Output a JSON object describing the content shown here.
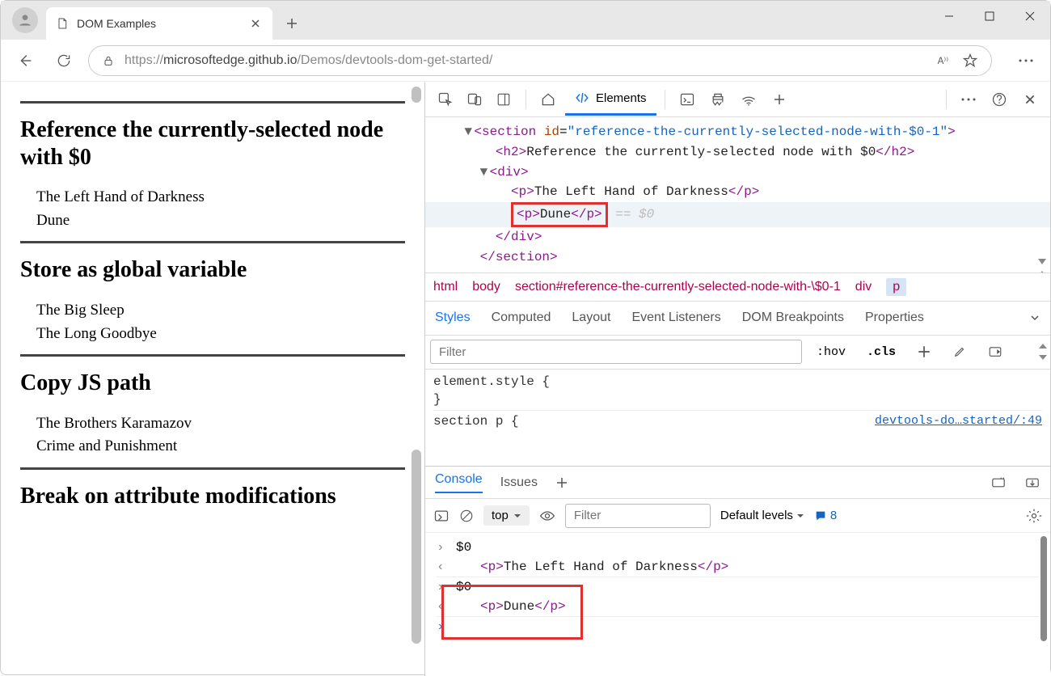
{
  "window": {
    "tab_title": "DOM Examples"
  },
  "address": {
    "scheme": "https://",
    "host": "microsoftedge.github.io",
    "path": "/Demos/devtools-dom-get-started/"
  },
  "page": {
    "sections": [
      {
        "heading": "Reference the currently-selected node with $0",
        "items": [
          "The Left Hand of Darkness",
          "Dune"
        ]
      },
      {
        "heading": "Store as global variable",
        "items": [
          "The Big Sleep",
          "The Long Goodbye"
        ]
      },
      {
        "heading": "Copy JS path",
        "items": [
          "The Brothers Karamazov",
          "Crime and Punishment"
        ]
      },
      {
        "heading": "Break on attribute modifications",
        "items": []
      }
    ]
  },
  "devtools": {
    "active_tab": "Elements",
    "dom": {
      "section_open": "<section id=\"reference-the-currently-selected-node-with-$0-1\">",
      "h2": "<h2>Reference the currently-selected node with $0</h2>",
      "div_open": "<div>",
      "p1": "<p>The Left Hand of Darkness</p>",
      "p2": "<p>Dune</p>",
      "eq0": " == $0",
      "div_close": "</div>",
      "section_close": "</section>"
    },
    "breadcrumb": [
      "html",
      "body",
      "section#reference-the-currently-selected-node-with-\\$0-1",
      "div",
      "p"
    ],
    "styles_tabs": [
      "Styles",
      "Computed",
      "Layout",
      "Event Listeners",
      "DOM Breakpoints",
      "Properties"
    ],
    "styles_filter_placeholder": "Filter",
    "styles_toolbar": {
      "hov": ":hov",
      "cls": ".cls"
    },
    "styles_rules": {
      "element_style": "element.style {",
      "brace": "}",
      "section_p": "section p {",
      "source_link": "devtools-do…started/:49"
    },
    "drawer": {
      "tabs": [
        "Console",
        "Issues"
      ],
      "context": "top",
      "filter_placeholder": "Filter",
      "levels": "Default levels",
      "message_count": "8",
      "lines": [
        {
          "mark": ">",
          "text": "$0"
        },
        {
          "mark": "<",
          "html": "<p>The Left Hand of Darkness</p>"
        },
        {
          "mark": ">",
          "text": "$0"
        },
        {
          "mark": "<",
          "html": "<p>Dune</p>"
        },
        {
          "mark": ">",
          "text": ""
        }
      ]
    }
  }
}
